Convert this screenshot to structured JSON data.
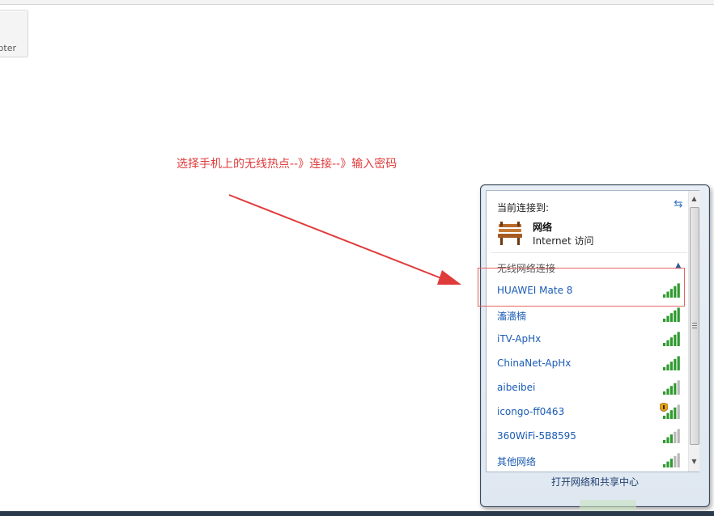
{
  "background_tile": {
    "label": "pter"
  },
  "annotation": {
    "text": "选择手机上的无线热点--》连接--》输入密码",
    "color": "#e03b3b"
  },
  "popup": {
    "current_title": "当前连接到:",
    "current_network": {
      "name": "网络",
      "access": "Internet 访问"
    },
    "wireless_section": "无线网络连接",
    "networks": [
      {
        "name": "HUAWEI Mate 8",
        "signal": 5,
        "secured": false
      },
      {
        "name": "滀濇楠",
        "signal": 5,
        "secured": false
      },
      {
        "name": "iTV-ApHx",
        "signal": 5,
        "secured": false
      },
      {
        "name": "ChinaNet-ApHx",
        "signal": 5,
        "secured": false
      },
      {
        "name": "aibeibei",
        "signal": 4,
        "secured": false
      },
      {
        "name": "icongo-ff0463",
        "signal": 4,
        "secured": true
      },
      {
        "name": "360WiFi-5B8595",
        "signal": 3,
        "secured": false
      },
      {
        "name": "其他网络",
        "signal": 3,
        "secured": false
      }
    ],
    "footer_link": "打开网络和共享中心"
  },
  "icons": {
    "refresh": "refresh-icon",
    "bench": "network-bench-icon",
    "signal": "wifi-signal-icon",
    "shield": "security-shield-icon"
  },
  "colors": {
    "link": "#1a5bb4",
    "signal_on": "#2f9a2f",
    "signal_off": "#b9b9b9"
  }
}
